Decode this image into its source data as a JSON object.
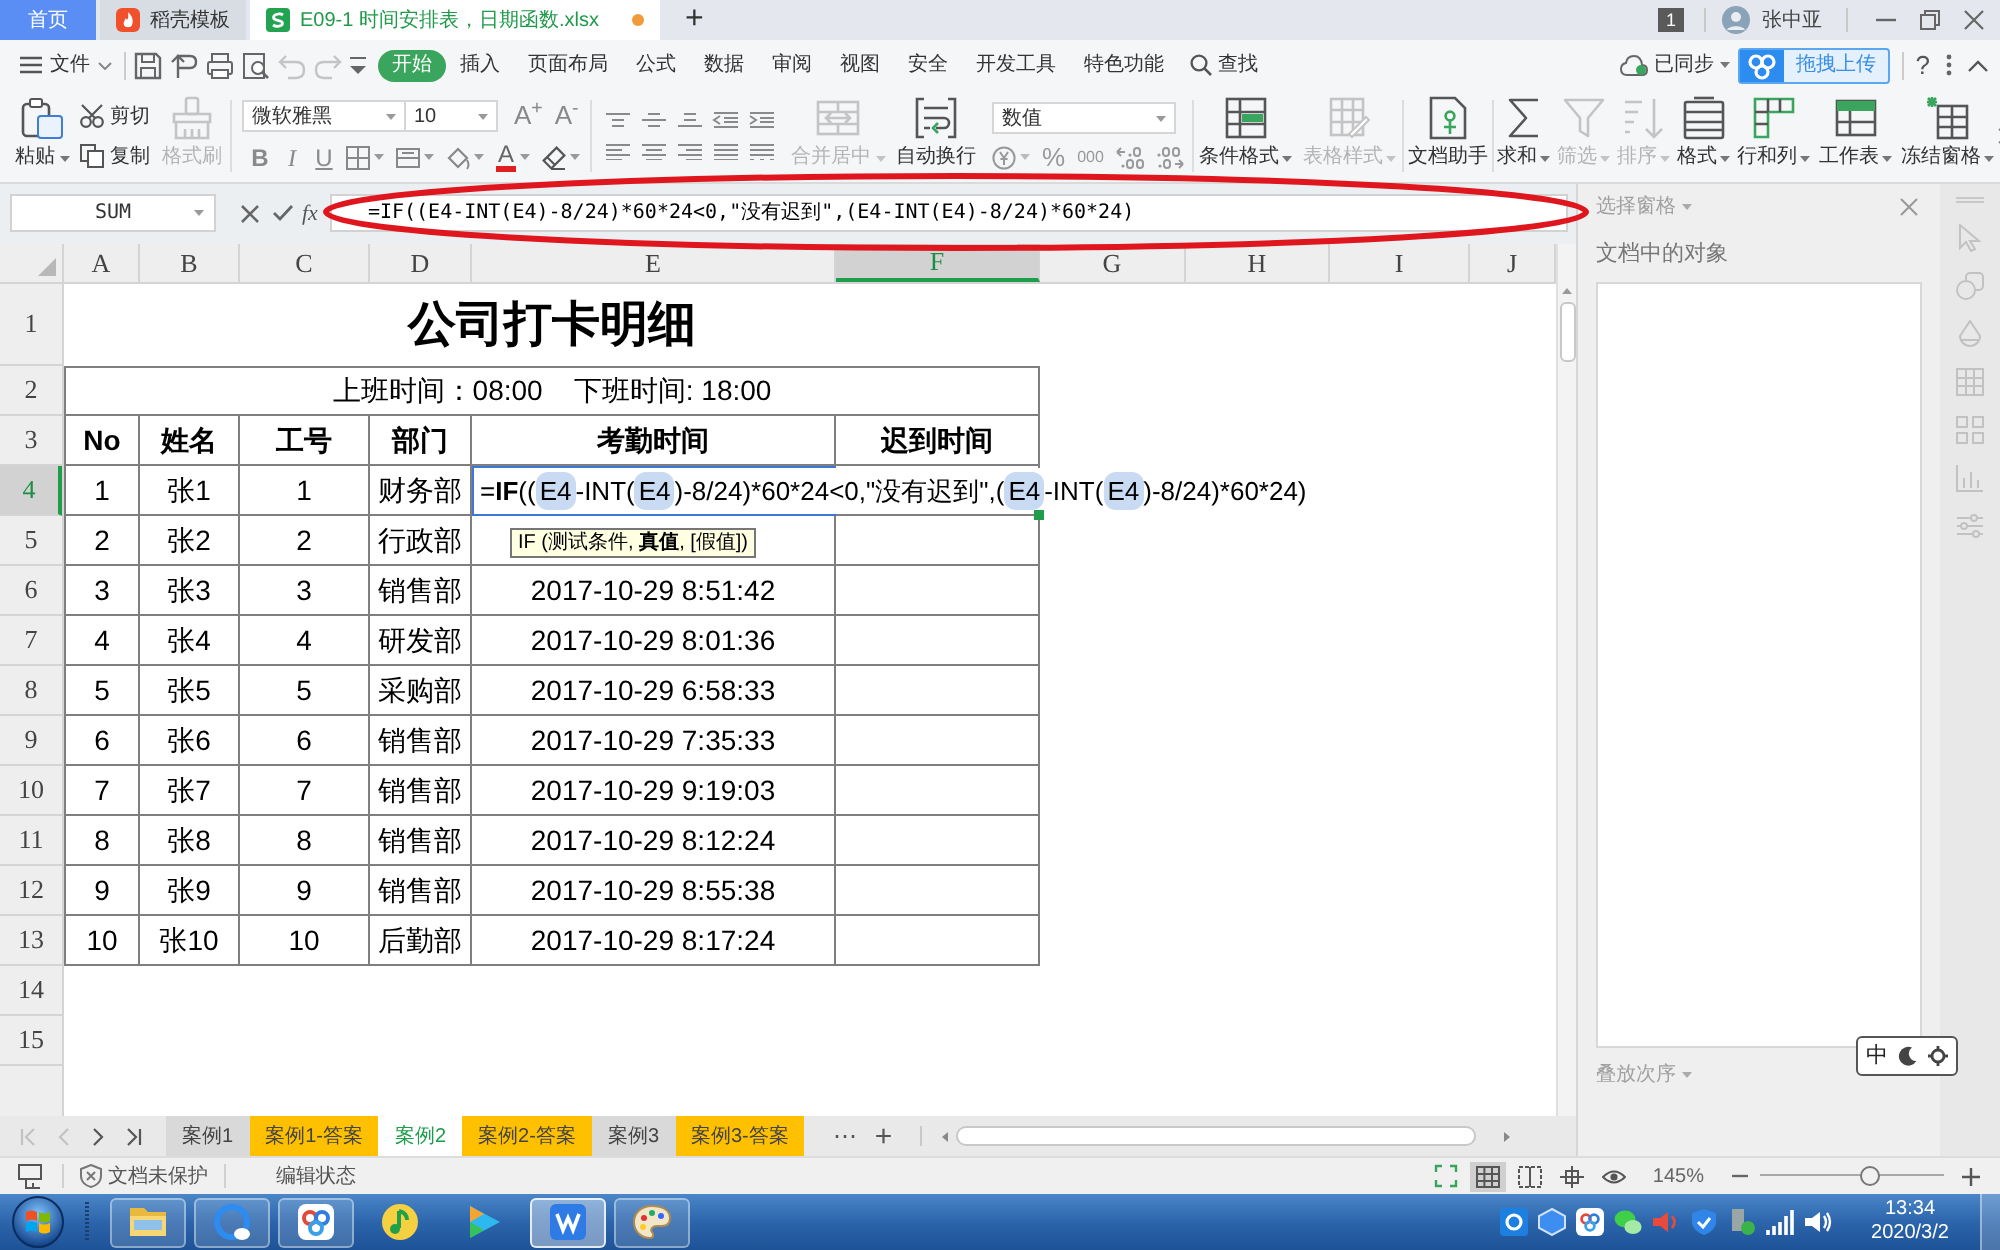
{
  "tabs": [
    {
      "label": "首页",
      "kind": "home",
      "selected": false
    },
    {
      "label": "稻壳模板",
      "kind": "docer",
      "selected": false
    },
    {
      "label": "E09-1 时间安排表，日期函数.xlsx",
      "kind": "sheet",
      "selected": true,
      "modified": true
    }
  ],
  "new_tab": "+",
  "account": {
    "badge": "1",
    "user": "张中亚"
  },
  "menu": {
    "file": "文件",
    "quick_access": [
      {
        "kind": "save",
        "disabled": false
      },
      {
        "kind": "export",
        "disabled": false
      },
      {
        "kind": "print",
        "disabled": false
      },
      {
        "kind": "preview",
        "disabled": false
      },
      {
        "kind": "undo",
        "disabled": true
      },
      {
        "kind": "redo",
        "disabled": true
      },
      {
        "kind": "customize",
        "disabled": false
      }
    ],
    "items": [
      {
        "label": "开始",
        "selected": true
      },
      {
        "label": "插入",
        "selected": false
      },
      {
        "label": "页面布局",
        "selected": false
      },
      {
        "label": "公式",
        "selected": false
      },
      {
        "label": "数据",
        "selected": false
      },
      {
        "label": "审阅",
        "selected": false
      },
      {
        "label": "视图",
        "selected": false
      },
      {
        "label": "安全",
        "selected": false
      },
      {
        "label": "开发工具",
        "selected": false
      },
      {
        "label": "特色功能",
        "selected": false
      }
    ],
    "search": "查找",
    "sync": "已同步",
    "upload": "拖拽上传",
    "help": "?"
  },
  "ribbon": {
    "paste": "粘贴",
    "cut": "剪切",
    "copy": "复制",
    "painter": {
      "label": "格式刷",
      "disabled": true
    },
    "font": {
      "name": "微软雅黑",
      "size": "10",
      "grow": "A$^{+}$",
      "shrink": "A$^{-}$",
      "styles": [
        {
          "label": "B",
          "kind": "bold"
        },
        {
          "label": "I",
          "kind": "italic"
        },
        {
          "label": "U",
          "kind": "underline"
        }
      ],
      "color_label": "A"
    },
    "align_tools": [
      {
        "label": "合并居中",
        "kind": "merge",
        "dropdown": true,
        "disabled": true
      },
      {
        "label": "自动换行",
        "kind": "wrap",
        "dropdown": false,
        "disabled": false
      }
    ],
    "number": {
      "format": "数值",
      "percent": "%",
      "thousands": "000"
    },
    "tools": [
      {
        "label": "条件格式",
        "kind": "conditional",
        "dropdown": true,
        "disabled": false
      },
      {
        "label": "表格样式",
        "kind": "table_style",
        "dropdown": true,
        "disabled": true
      },
      {
        "label": "文档助手",
        "kind": "assistant",
        "dropdown": false,
        "disabled": false
      },
      {
        "label": "求和",
        "kind": "sum",
        "dropdown": true,
        "disabled": false
      },
      {
        "label": "筛选",
        "kind": "filter",
        "dropdown": true,
        "disabled": true
      },
      {
        "label": "排序",
        "kind": "sort",
        "dropdown": true,
        "disabled": true
      },
      {
        "label": "格式",
        "kind": "format",
        "dropdown": true,
        "disabled": false
      },
      {
        "label": "行和列",
        "kind": "rows_columns",
        "dropdown": true,
        "disabled": false
      },
      {
        "label": "工作表",
        "kind": "worksheet",
        "dropdown": true,
        "disabled": false
      },
      {
        "label": "冻结窗格",
        "kind": "freeze",
        "dropdown": true,
        "disabled": false
      }
    ]
  },
  "formula_bar": {
    "name_box": "SUM",
    "fx": "fx",
    "formula": "=IF((E4-INT(E4)-8/24)*60*24<0,\"没有迟到\",(E4-INT(E4)-8/24)*60*24)"
  },
  "columns": [
    {
      "label": "A",
      "selected": false
    },
    {
      "label": "B",
      "selected": false
    },
    {
      "label": "C",
      "selected": false
    },
    {
      "label": "D",
      "selected": false
    },
    {
      "label": "E",
      "selected": false
    },
    {
      "label": "F",
      "selected": true
    },
    {
      "label": "G",
      "selected": false
    },
    {
      "label": "H",
      "selected": false
    },
    {
      "label": "I",
      "selected": false
    },
    {
      "label": "J",
      "selected": false
    }
  ],
  "row_headers": [
    {
      "label": "1",
      "selected": false
    },
    {
      "label": "2",
      "selected": false
    },
    {
      "label": "3",
      "selected": false
    },
    {
      "label": "4",
      "selected": true
    },
    {
      "label": "5",
      "selected": false
    },
    {
      "label": "6",
      "selected": false
    },
    {
      "label": "7",
      "selected": false
    },
    {
      "label": "8",
      "selected": false
    },
    {
      "label": "9",
      "selected": false
    },
    {
      "label": "10",
      "selected": false
    },
    {
      "label": "11",
      "selected": false
    },
    {
      "label": "12",
      "selected": false
    },
    {
      "label": "13",
      "selected": false
    },
    {
      "label": "14",
      "selected": false
    },
    {
      "label": "15",
      "selected": false
    }
  ],
  "sheet": {
    "title": "公司打卡明细",
    "schedule": "上班时间：08:00    下班时间: 18:00",
    "headers": [
      "No",
      "姓名",
      "工号",
      "部门",
      "考勤时间",
      "迟到时间"
    ],
    "rows": [
      [
        "1",
        "张1",
        "1",
        "财务部"
      ],
      [
        "2",
        "张2",
        "2",
        "行政部"
      ],
      [
        "3",
        "张3",
        "3",
        "销售部",
        "2017-10-29 8:51:42"
      ],
      [
        "4",
        "张4",
        "4",
        "研发部",
        "2017-10-29 8:01:36"
      ],
      [
        "5",
        "张5",
        "5",
        "采购部",
        "2017-10-29 6:58:33"
      ],
      [
        "6",
        "张6",
        "6",
        "销售部",
        "2017-10-29 7:35:33"
      ],
      [
        "7",
        "张7",
        "7",
        "销售部",
        "2017-10-29 9:19:03"
      ],
      [
        "8",
        "张8",
        "8",
        "销售部",
        "2017-10-29 8:12:24"
      ],
      [
        "9",
        "张9",
        "9",
        "销售部",
        "2017-10-29 8:55:38"
      ],
      [
        "10",
        "张10",
        "10",
        "后勤部",
        "2017-10-29 8:17:24"
      ]
    ]
  },
  "editor": {
    "parts": [
      {
        "text": "=",
        "kind": "plain"
      },
      {
        "text": "IF",
        "kind": "function"
      },
      {
        "text": "((",
        "kind": "plain"
      },
      {
        "text": "E4",
        "kind": "reference"
      },
      {
        "text": "-INT(",
        "kind": "plain"
      },
      {
        "text": "E4",
        "kind": "reference"
      },
      {
        "text": ")-8/24)*60*24<0,\"没有迟到\",(",
        "kind": "plain"
      },
      {
        "text": "E4",
        "kind": "reference"
      },
      {
        "text": "-INT(",
        "kind": "plain"
      },
      {
        "text": "E4",
        "kind": "reference"
      },
      {
        "text": ")-8/24)*60*24)",
        "kind": "plain"
      }
    ]
  },
  "tooltip": "IF (测试条件, **真值**, [假值])",
  "sheet_nav": [
    {
      "kind": "first",
      "disabled": true
    },
    {
      "kind": "prev",
      "disabled": true
    },
    {
      "kind": "next",
      "disabled": false
    },
    {
      "kind": "last",
      "disabled": false
    }
  ],
  "sheet_tabs": [
    {
      "label": "案例1",
      "selected": false
    },
    {
      "label": "案例1-答案",
      "selected": false,
      "color": "#ffc000"
    },
    {
      "label": "案例2",
      "selected": true
    },
    {
      "label": "案例2-答案",
      "selected": false,
      "color": "#ffc000"
    },
    {
      "label": "案例3",
      "selected": false
    },
    {
      "label": "案例3-答案",
      "selected": false,
      "color": "#ffc000"
    }
  ],
  "sheet_more": "⋯",
  "sheet_add": "+",
  "side_panel": {
    "title": "选择窗格",
    "section": "文档中的对象",
    "order": "叠放次序"
  },
  "ime": "中",
  "status": {
    "protection": "文档未保护",
    "mode": "编辑状态",
    "views": [
      {
        "kind": "normal",
        "selected": true
      },
      {
        "kind": "page_break",
        "selected": false
      },
      {
        "kind": "reading",
        "selected": false
      },
      {
        "kind": "eye_care",
        "selected": false
      }
    ],
    "zoom": {
      "label": "145%",
      "level": 0.6
    }
  },
  "taskbar": {
    "apps": [
      {
        "kind": "explorer",
        "running": true,
        "active": false
      },
      {
        "kind": "browser",
        "running": true,
        "active": false
      },
      {
        "kind": "netdisk",
        "running": true,
        "active": false
      },
      {
        "kind": "music",
        "running": false,
        "active": false
      },
      {
        "kind": "video",
        "running": false,
        "active": false
      },
      {
        "kind": "wps",
        "running": true,
        "active": true
      },
      {
        "kind": "paint",
        "running": true,
        "active": false
      }
    ],
    "time": "13:34",
    "date": "2020/3/2"
  }
}
